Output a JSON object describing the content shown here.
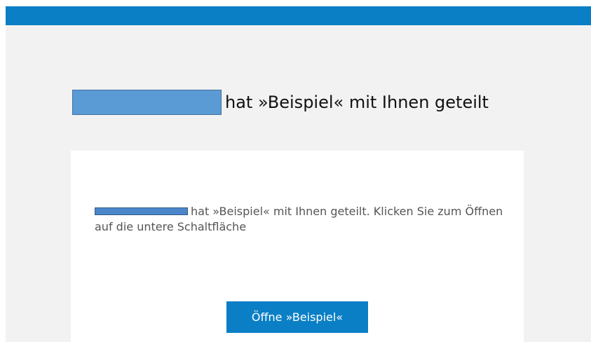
{
  "header": {
    "title_text": "hat »Beispiel« mit Ihnen geteilt",
    "sender_redacted": true,
    "bar_color": "#0a7fc6"
  },
  "card": {
    "message_text": "hat »Beispiel« mit Ihnen geteilt. Klicken Sie zum Öffnen auf die untere Schaltfläche",
    "button_label": "Öffne »Beispiel«"
  }
}
